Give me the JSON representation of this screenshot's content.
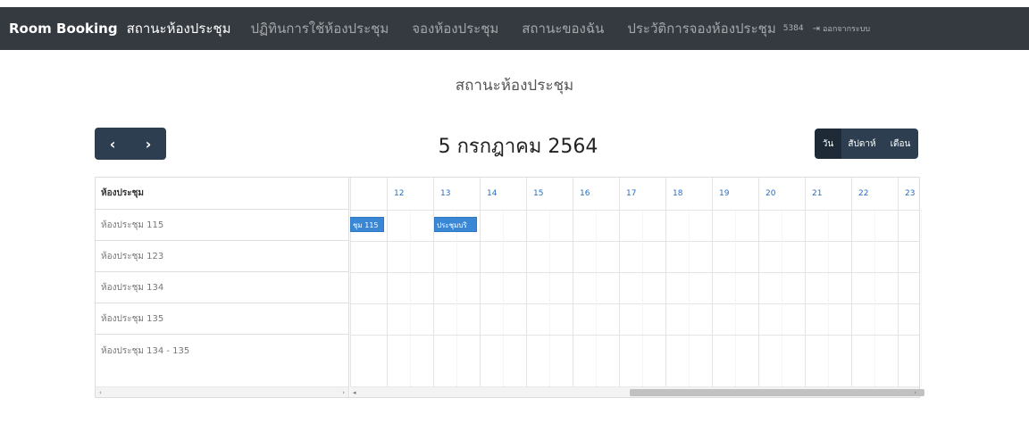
{
  "navbar": {
    "brand": "Room Booking",
    "links": [
      "สถานะห้องประชุม",
      "ปฏิทินการใช้ห้องประชุม",
      "จองห้องประชุม",
      "สถานะของฉัน",
      "ประวัติการจองห้องประชุม"
    ],
    "active_index": 0,
    "user": "5384",
    "logout_label": "ออกจากระบบ"
  },
  "page_title": "สถานะห้องประชุม",
  "calendar": {
    "prev_label": "‹",
    "next_label": "›",
    "title": "5 กรกฎาคม 2564",
    "views": [
      {
        "label": "วัน",
        "active": true
      },
      {
        "label": "สัปดาห์",
        "active": false
      },
      {
        "label": "เดือน",
        "active": false
      }
    ],
    "resource_header": "ห้องประชุม",
    "resources": [
      "ห้องประชุม 115",
      "ห้องประชุม 123",
      "ห้องประชุม 134",
      "ห้องประชุม 135",
      "ห้องประชุม 134 - 135"
    ],
    "time_slots": [
      "",
      "12",
      "13",
      "14",
      "15",
      "16",
      "17",
      "18",
      "19",
      "20",
      "21",
      "22",
      "23"
    ],
    "events": [
      {
        "label": "ชุม 115",
        "resource_index": 0
      },
      {
        "label": "ประชุมบริ",
        "resource_index": 0
      }
    ]
  },
  "colors": {
    "navbar": "#343a40",
    "button": "#2c3e50",
    "event": "#3a87d6",
    "slot_label": "#2a6ebb"
  }
}
